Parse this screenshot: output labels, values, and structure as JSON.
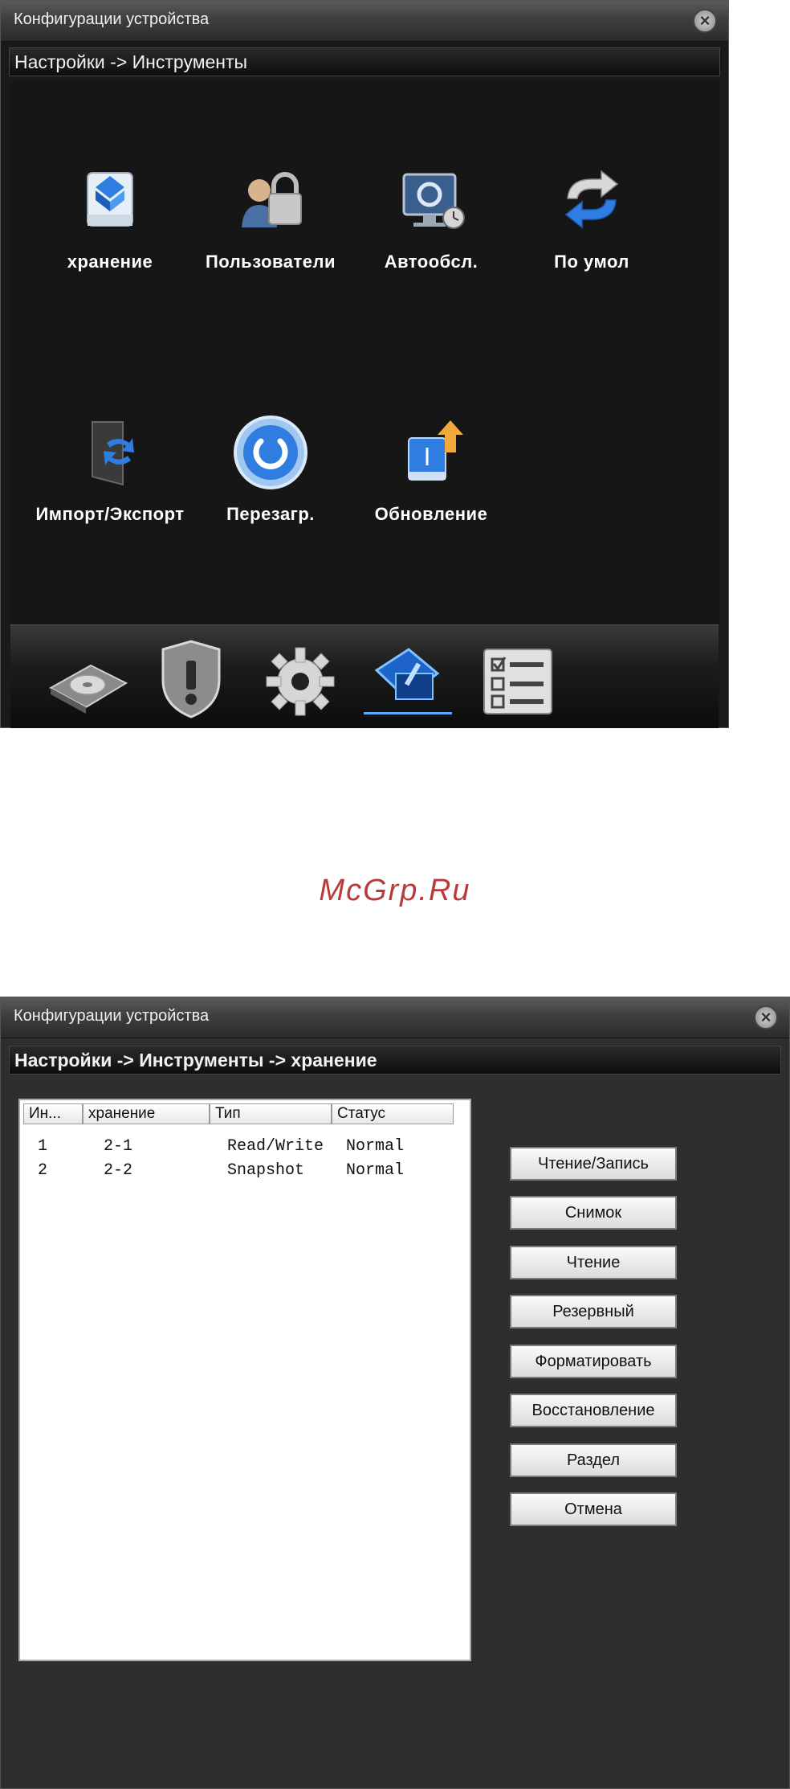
{
  "window1": {
    "title": "Конфигурации устройства",
    "close_icon": "close-icon",
    "breadcrumb": "Настройки -> Инструменты",
    "tools": [
      {
        "label": "хранение",
        "icon": "storage-icon"
      },
      {
        "label": "Пользователи",
        "icon": "users-lock-icon"
      },
      {
        "label": "Автообсл.",
        "icon": "auto-maintenance-icon"
      },
      {
        "label": "По умол",
        "icon": "restore-default-icon"
      },
      {
        "label": "Импорт/Экспорт",
        "icon": "import-export-icon"
      },
      {
        "label": "Перезагр.",
        "icon": "reboot-icon"
      },
      {
        "label": "Обновление",
        "icon": "update-icon"
      }
    ],
    "bottom_tabs": [
      {
        "icon": "disk-icon"
      },
      {
        "icon": "alarm-shield-icon"
      },
      {
        "icon": "gear-icon"
      },
      {
        "icon": "tools-icon",
        "active": true
      },
      {
        "icon": "info-checklist-icon"
      }
    ]
  },
  "watermark": "McGrp.Ru",
  "window2": {
    "title": "Конфигурации устройства",
    "breadcrumb": "Настройки -> Инструменты -> хранение",
    "columns": [
      "Ин...",
      "хранение",
      "Тип",
      "Статус"
    ],
    "rows": [
      {
        "index": "1",
        "storage": "2-1",
        "type": "Read/Write",
        "status": "Normal"
      },
      {
        "index": "2",
        "storage": "2-2",
        "type": "Snapshot",
        "status": "Normal"
      }
    ],
    "buttons": [
      "Чтение/Запись",
      "Снимок",
      "Чтение",
      "Резервный",
      "Форматировать",
      "Восстановление",
      "Раздел",
      "Отмена"
    ]
  },
  "colors": {
    "window_bg": "#1a1a1a",
    "accent_blue": "#2f7de1",
    "watermark": "#b83a3a"
  }
}
